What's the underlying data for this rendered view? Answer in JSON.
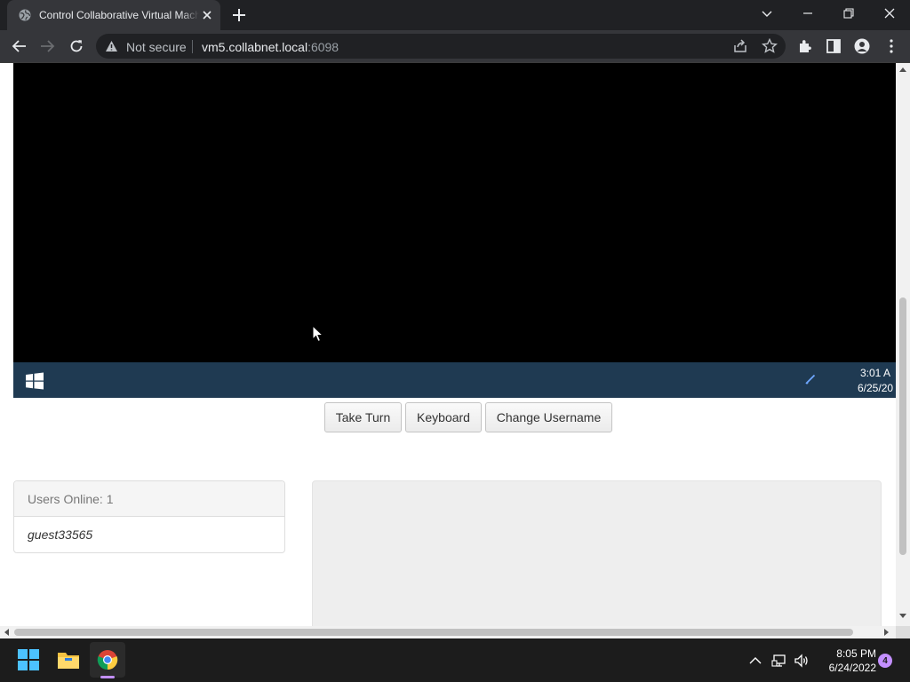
{
  "browser": {
    "tab_title": "Control Collaborative Virtual Machine",
    "omnibox": {
      "security_text": "Not secure",
      "url_host": "vm5.collabnet.local",
      "url_port": ":6098"
    }
  },
  "vm": {
    "clock_time": "3:01 A",
    "clock_date": "6/25/20"
  },
  "controls": {
    "take_turn": "Take Turn",
    "keyboard": "Keyboard",
    "change_username": "Change Username"
  },
  "users": {
    "heading": "Users Online: 1",
    "list": [
      "guest33565"
    ]
  },
  "taskbar": {
    "time": "8:05 PM",
    "date": "6/24/2022",
    "notification_count": "4"
  },
  "colors": {
    "browser_bg": "#202124",
    "toolbar_bg": "#35363a",
    "vm_taskbar": "#1f3a52",
    "accent": "#c38fff"
  }
}
